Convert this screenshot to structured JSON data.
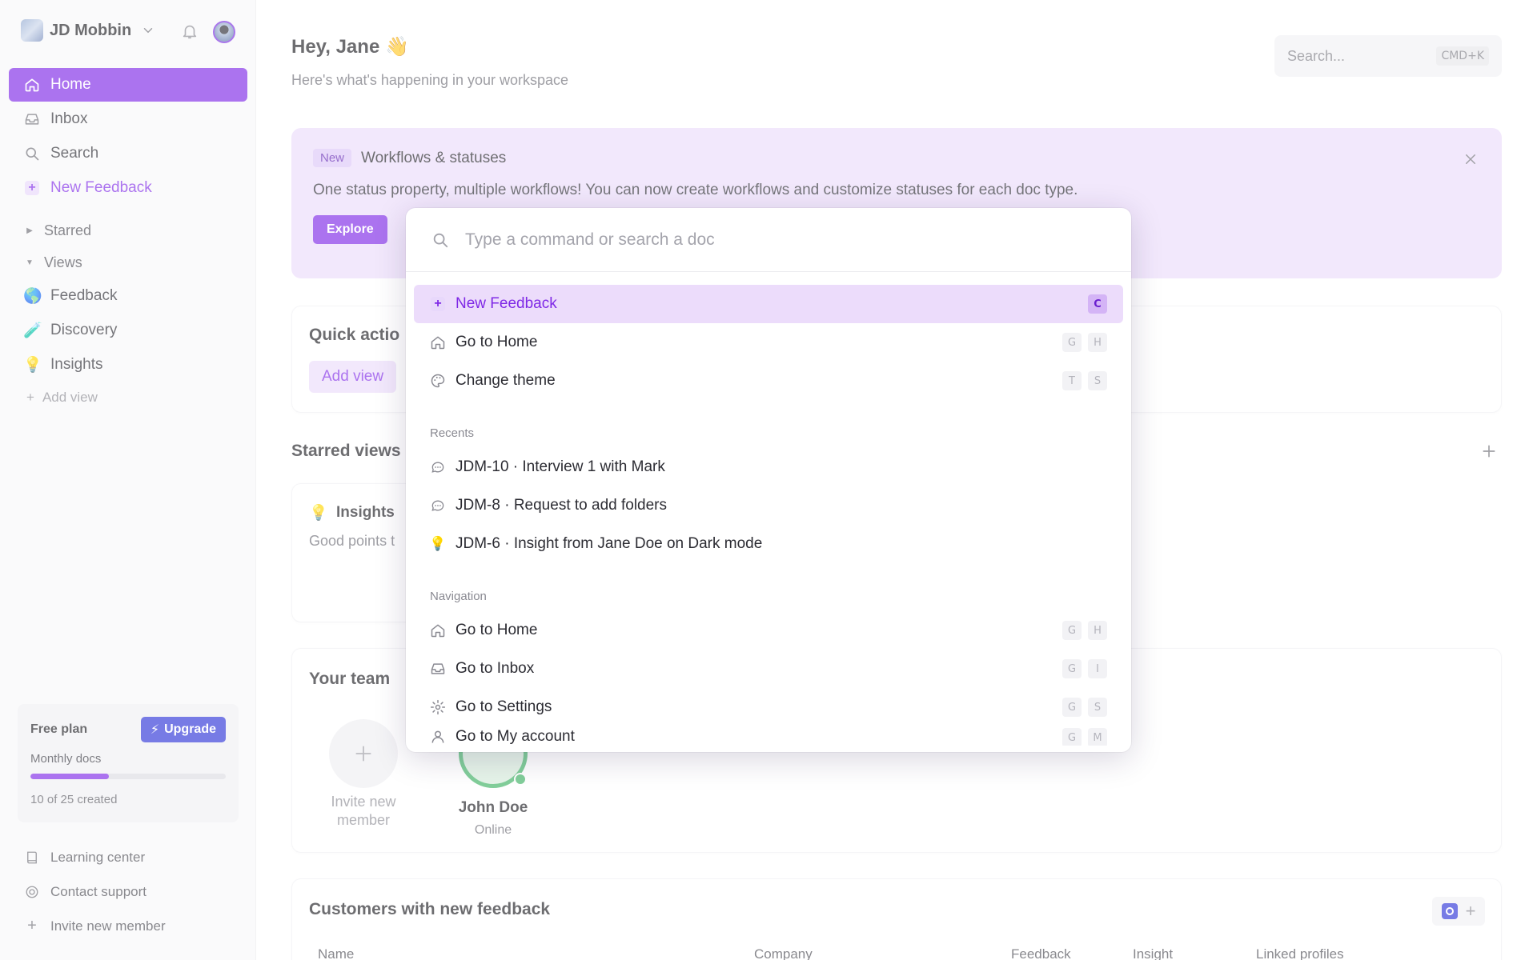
{
  "workspace": {
    "name": "JD Mobbin"
  },
  "sidebar": {
    "nav": [
      {
        "label": "Home",
        "icon": "home-icon"
      },
      {
        "label": "Inbox",
        "icon": "inbox-icon"
      },
      {
        "label": "Search",
        "icon": "search-icon"
      },
      {
        "label": "New Feedback",
        "icon": "plus-icon"
      }
    ],
    "starred_label": "Starred",
    "views_label": "Views",
    "views": [
      {
        "label": "Feedback",
        "emoji": "🌎"
      },
      {
        "label": "Discovery",
        "emoji": "🧪"
      },
      {
        "label": "Insights",
        "emoji": "💡"
      }
    ],
    "add_view": "Add view",
    "plan": {
      "title": "Free plan",
      "upgrade": "Upgrade",
      "subtitle": "Monthly docs",
      "used": 10,
      "total": 25,
      "count_text": "10 of 25 created"
    },
    "footer": [
      {
        "label": "Learning center",
        "icon": "book-icon"
      },
      {
        "label": "Contact support",
        "icon": "support-icon"
      },
      {
        "label": "Invite new member",
        "icon": "plus-icon"
      }
    ]
  },
  "header": {
    "greeting": "Hey, Jane 👋",
    "subtitle": "Here's what's happening in your workspace",
    "search_placeholder": "Search...",
    "search_shortcut": "CMD+K"
  },
  "banner": {
    "badge": "New",
    "title": "Workflows & statuses",
    "text": "One status property, multiple workflows! You can now create workflows and customize statuses for each doc type.",
    "button": "Explore"
  },
  "quick_actions": {
    "title": "Quick actio",
    "button": "Add view"
  },
  "starred_views": {
    "title": "Starred views",
    "card": {
      "title": "Insights",
      "emoji": "💡",
      "desc": "Good points t"
    }
  },
  "team": {
    "title": "Your team",
    "invite": "Invite new member",
    "member": {
      "name": "John Doe",
      "status": "Online"
    }
  },
  "customers": {
    "title": "Customers with new feedback",
    "columns": [
      "Name",
      "Company",
      "Feedback",
      "Insight",
      "Linked profiles"
    ]
  },
  "palette": {
    "placeholder": "Type a command or search a doc",
    "top": [
      {
        "label": "New Feedback",
        "icon": "plus-icon",
        "keys": [
          "C"
        ],
        "selected": true
      },
      {
        "label": "Go to Home",
        "icon": "home-icon",
        "keys": [
          "G",
          "H"
        ]
      },
      {
        "label": "Change theme",
        "icon": "palette-icon",
        "keys": [
          "T",
          "S"
        ]
      }
    ],
    "recents_label": "Recents",
    "recents": [
      {
        "label": "JDM-10 · Interview 1 with Mark",
        "icon": "chat-bubble-icon"
      },
      {
        "label": "JDM-8 · Request to add folders",
        "icon": "chat-bubble-icon"
      },
      {
        "label": "JDM-6 · Insight from Jane Doe on Dark mode",
        "icon": "lightbulb-icon"
      }
    ],
    "navigation_label": "Navigation",
    "navigation": [
      {
        "label": "Go to Home",
        "icon": "home-icon",
        "keys": [
          "G",
          "H"
        ]
      },
      {
        "label": "Go to Inbox",
        "icon": "inbox-icon",
        "keys": [
          "G",
          "I"
        ]
      },
      {
        "label": "Go to Settings",
        "icon": "settings-icon",
        "keys": [
          "G",
          "S"
        ]
      },
      {
        "label": "Go to My account",
        "icon": "user-icon",
        "keys": [
          "G",
          "M"
        ]
      }
    ]
  },
  "colors": {
    "accent": "#7f29e6",
    "accent_soft": "#ecdcfb",
    "upgrade": "#2f35d8",
    "online": "#3fb465"
  }
}
